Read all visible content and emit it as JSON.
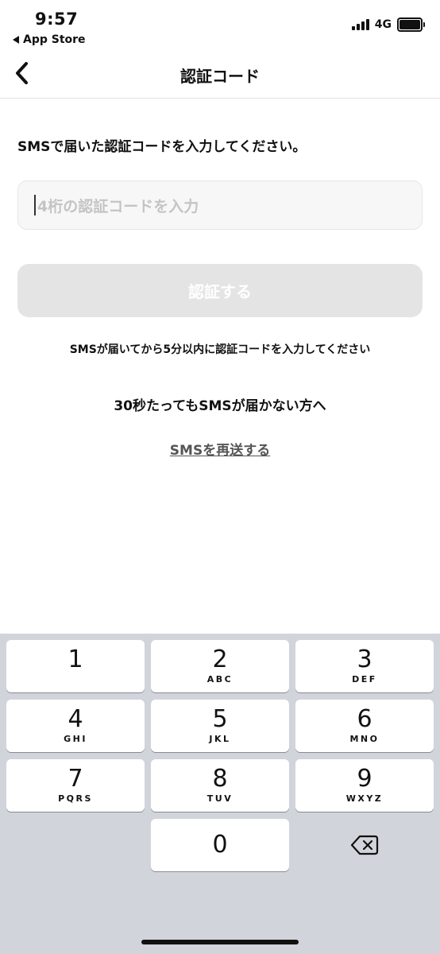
{
  "status_bar": {
    "time": "9:57",
    "back_app_label": "App Store",
    "network": "4G"
  },
  "nav": {
    "title": "認証コード"
  },
  "form": {
    "instruction": "SMSで届いた認証コードを入力してください。",
    "code_input": {
      "value": "",
      "placeholder": "4桁の認証コードを入力"
    },
    "submit_label": "認証する",
    "note": "SMSが届いてから5分以内に認証コードを入力してください",
    "no_sms_text": "30秒たってもSMSが届かない方へ",
    "resend_label": "SMSを再送する"
  },
  "keyboard": {
    "keys": [
      {
        "digit": "1",
        "letters": ""
      },
      {
        "digit": "2",
        "letters": "ABC"
      },
      {
        "digit": "3",
        "letters": "DEF"
      },
      {
        "digit": "4",
        "letters": "GHI"
      },
      {
        "digit": "5",
        "letters": "JKL"
      },
      {
        "digit": "6",
        "letters": "MNO"
      },
      {
        "digit": "7",
        "letters": "PQRS"
      },
      {
        "digit": "8",
        "letters": "TUV"
      },
      {
        "digit": "9",
        "letters": "WXYZ"
      },
      {
        "digit": "0",
        "letters": ""
      }
    ],
    "delete_icon": "delete-backspace-icon"
  }
}
